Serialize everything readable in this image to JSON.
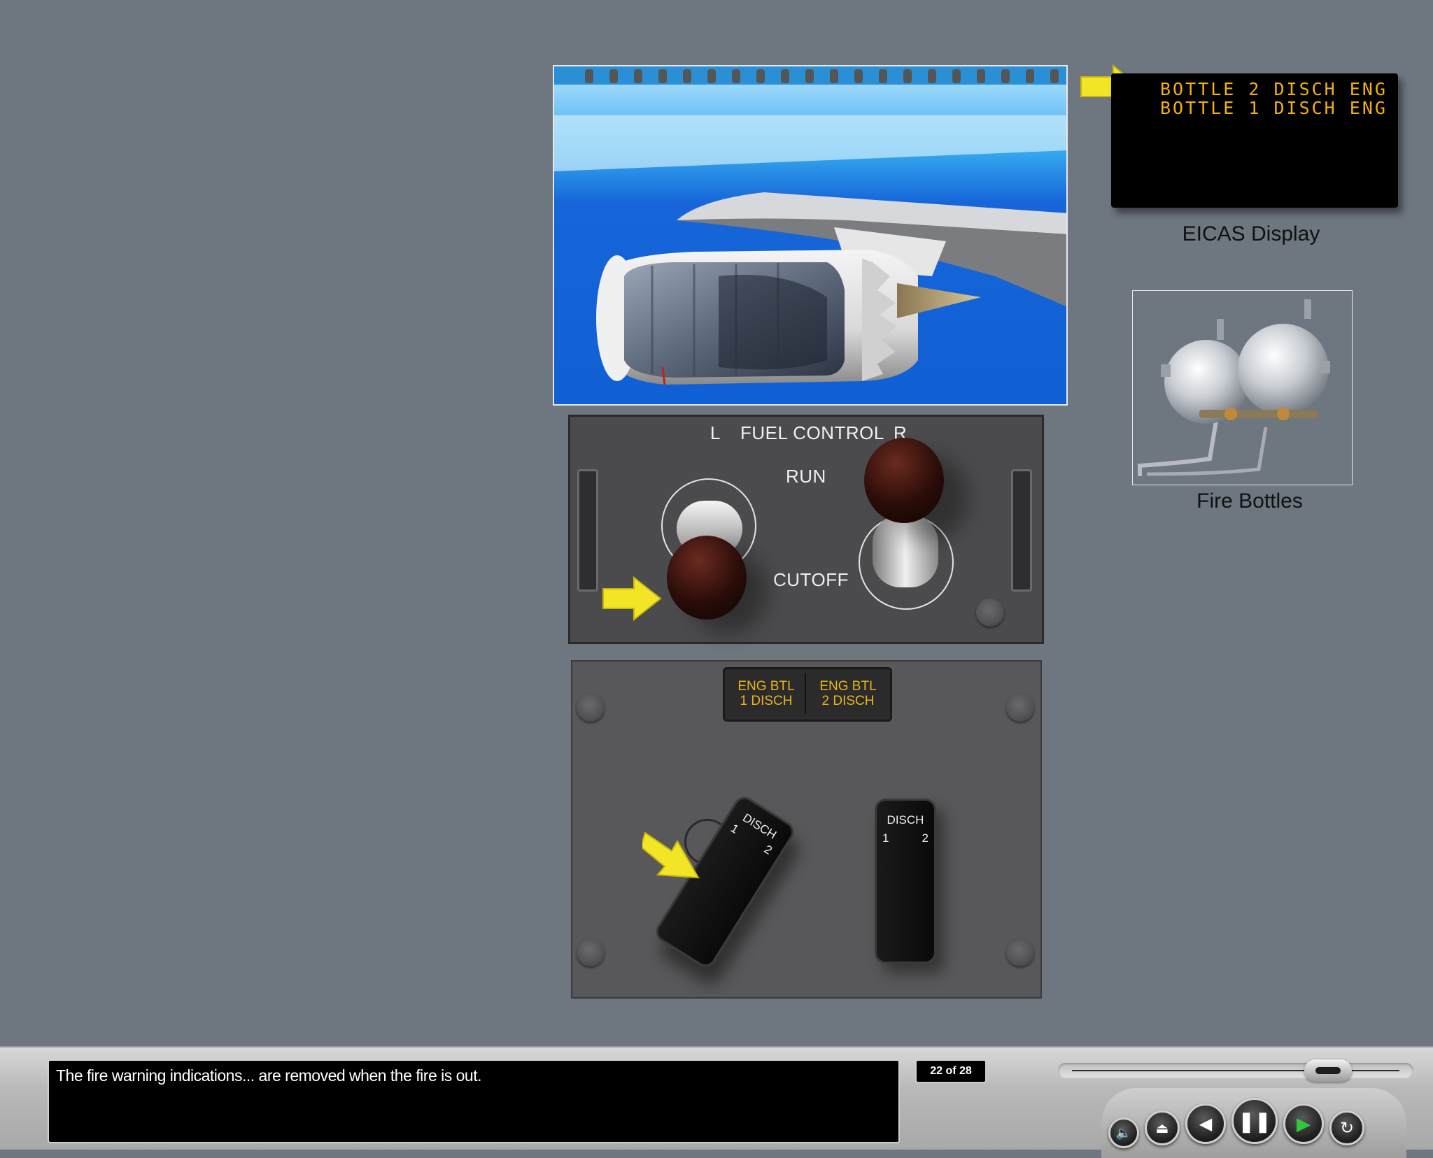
{
  "eicas": {
    "lines": [
      "BOTTLE 2 DISCH ENG",
      "BOTTLE 1 DISCH ENG"
    ],
    "caption": "EICAS Display"
  },
  "fire_bottles": {
    "caption": "Fire Bottles"
  },
  "fuel_control": {
    "left_label": "L",
    "title": "FUEL CONTROL",
    "right_label": "R",
    "run_label": "RUN",
    "cutoff_label": "CUTOFF"
  },
  "discharge_panel": {
    "annunciator_1": [
      "ENG BTL",
      "1 DISCH"
    ],
    "annunciator_2": [
      "ENG BTL",
      "2 DISCH"
    ],
    "left_switch": {
      "label": "DISCH",
      "pos_1": "1",
      "pos_2": "2"
    },
    "right_switch": {
      "label": "DISCH",
      "pos_1": "1",
      "pos_2": "2"
    }
  },
  "player": {
    "caption": "The fire warning indications... are removed when the fire is out.",
    "slide_counter": "22 of 28",
    "progress": 0.76,
    "buttons": [
      "audio-icon",
      "eject-icon",
      "back-icon",
      "pause-icon",
      "play-icon",
      "replay-icon"
    ]
  },
  "colors": {
    "background": "#6e7680",
    "eicas_amber": "#f2b011",
    "annunciator_amber": "#e8b41e",
    "arrow_yellow": "#f2e526",
    "play_green": "#2fc83a"
  }
}
